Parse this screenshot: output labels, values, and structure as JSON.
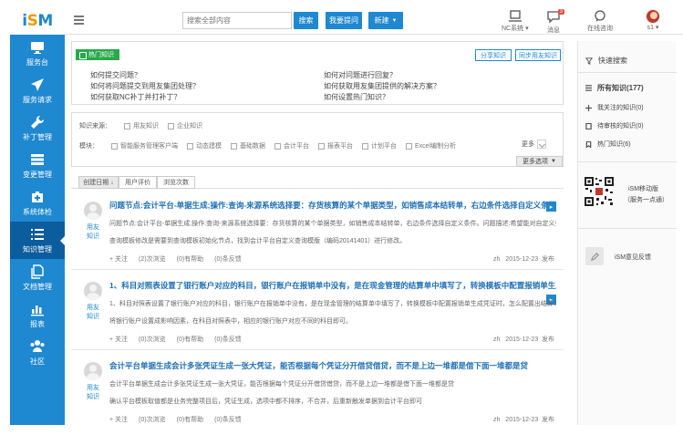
{
  "logo": {
    "text_i": "i",
    "text_s": "S",
    "text_m": "M"
  },
  "nav": [
    {
      "label": "服务台",
      "icon": "monitor-icon"
    },
    {
      "label": "服务请求",
      "icon": "send-icon"
    },
    {
      "label": "补丁管理",
      "icon": "wrench-icon"
    },
    {
      "label": "变更管理",
      "icon": "stack-icon"
    },
    {
      "label": "系统体检",
      "icon": "medkit-icon"
    },
    {
      "label": "知识管理",
      "icon": "list-icon"
    },
    {
      "label": "文档管理",
      "icon": "copy-icon"
    },
    {
      "label": "报表",
      "icon": "bar-chart-icon"
    },
    {
      "label": "社区",
      "icon": "group-icon"
    }
  ],
  "topbar": {
    "search_placeholder": "搜索全部内容",
    "search_btn": "搜索",
    "ask_btn": "我要提问",
    "new_btn": "新建",
    "nc_system": "NC系统",
    "messages": "消息",
    "messages_count": "3",
    "consult": "在线咨询",
    "user": "s1"
  },
  "hot": {
    "tag": "热门知识",
    "share_btn": "分享知识",
    "sync_btn": "同步用友知识",
    "links": [
      "如何提交问题？",
      "如何对问题进行回复？",
      "如何将问题提交到用友集团处理？",
      "如何获取用友集团提供的解决方案？",
      "如何获取NC补丁并打补丁？",
      "如何设置热门知识？"
    ]
  },
  "filters": {
    "source_label": "知识来源：",
    "sources": [
      "用友知识",
      "企业知识"
    ],
    "module_label": "模块：",
    "modules": [
      "智能服务管理客户端",
      "动态建模",
      "基础数据",
      "会计平台",
      "报表平台",
      "计划平台",
      "Excel编制分析"
    ],
    "more": "更多",
    "more_options": "更多选项"
  },
  "sort": [
    "创建日期",
    "用户评价",
    "浏览次数"
  ],
  "articles": [
    {
      "title": "问题节点:会计平台-单据生成;操作:查询-来源系统选择要：存货核算的某个单据类型，如销售成本结转单，右边条件选择自定义条件。问题描...",
      "line1": "问题节点:会计平台-单据生成;操作:查询-来源系统选择要：存货核算的某个单据类型，如销售成本结转单，右边条件选择自定义条件。问题描述:希望能对自定义条件里...",
      "line2": "查询模板修改是需要到查询模板初始化节点，找到会计平台自定义查询模版（编码20141401）进行修改。",
      "author": "用友知识",
      "follow": "+ 关注",
      "views": "(2)次浏览",
      "helpful": "(0)有帮助",
      "feedback": "(0)条反馈",
      "user": "zh",
      "date": "2015-12-23",
      "action": "发布"
    },
    {
      "title": "1、科目对照表设置了银行账户对应的科目，银行账户在报销单中没有，是在现金管理的结算单中填写了，转换模板中配置报销单生成凭证时，...",
      "line1": "1、科目对照表设置了银行账户对应的科目，银行账户在报销单中没有，是在现金管理的结算单中填写了，转换模板中配置报销单生成凭证时，怎么配置出结算单中的票...",
      "line2": "将银行账户设置成影响因素，在科目对照表中，相应的银行账户对应不同的科目即可。",
      "author": "用友知识",
      "follow": "+ 关注",
      "views": "(0)次浏览",
      "helpful": "(0)有帮助",
      "feedback": "(0)条反馈",
      "user": "zh",
      "date": "2015-12-23",
      "action": "发布"
    },
    {
      "title": "会计平台单据生成会计多张凭证生成一张大凭证，能否根据每个凭证分开借贷借贷，而不是上边一堆都是借下面一堆都是贷",
      "line1": "会计平台单据生成会计多张凭证生成一张大凭证，能否根据每个凭证分开借贷借贷，而不是上边一堆都是借下面一堆都是贷",
      "line2": "确认平台模板取值都是业务完整项目后，凭证生成，选项中都不排序，不合并，后重新触发单据到会计平台即可",
      "author": "用友知识",
      "follow": "+ 关注",
      "views": "(0)次浏览",
      "helpful": "(0)有帮助",
      "feedback": "(0)条反馈",
      "user": "zh",
      "date": "2015-12-23",
      "action": "发布"
    }
  ],
  "right": {
    "quick_search": "快速搜索",
    "all": "所有知识(177)",
    "followed": "我关注的知识(0)",
    "pending": "待审核的知识(0)",
    "hot": "热门知识(6)",
    "mobile1": "iSM移动版",
    "mobile2": "（服务一点通）",
    "feedback": "iSM意见反馈"
  }
}
